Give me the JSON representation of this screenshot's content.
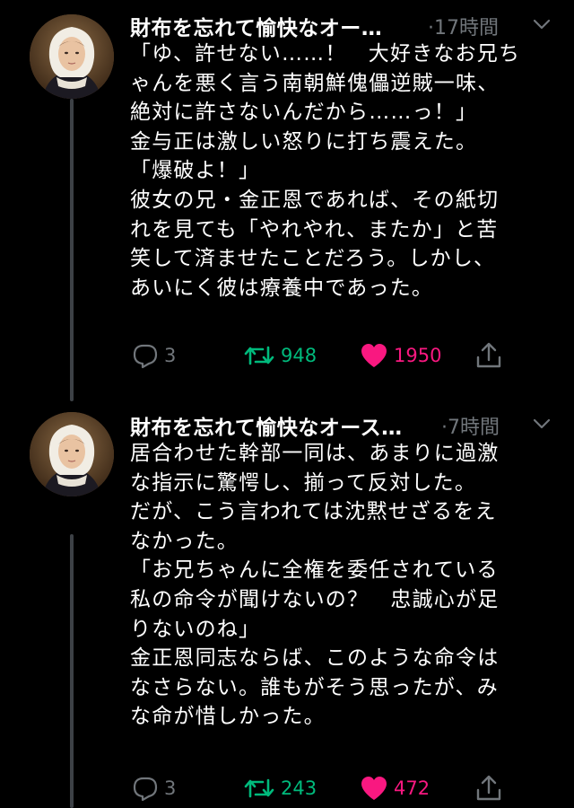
{
  "theme": {
    "background": "#000000",
    "muted": "#71767b",
    "retweet_green": "#00ba7c",
    "like_pink": "#f91880"
  },
  "tweets": [
    {
      "author": "財布を忘れて愉快なオー…",
      "time": "·17時間",
      "avatar_icon": "portrait-woman-bonnet-icon",
      "lines": [
        "「ゆ、許せない……！　大好きなお兄ち",
        "ゃんを悪く言う南朝鮮傀儡逆賊一味、",
        "絶対に許さないんだから……っ！」",
        "金与正は激しい怒りに打ち震えた。",
        "「爆破よ！」",
        "彼女の兄・金正恩であれば、その紙切",
        "れを見ても「やれやれ、またか」と苦",
        "笑して済ませたことだろう。しかし、",
        "あいにく彼は療養中であった。"
      ],
      "replies": "3",
      "retweets": "948",
      "likes": "1950"
    },
    {
      "author": "財布を忘れて愉快なオース…",
      "time": "·7時間",
      "avatar_icon": "portrait-woman-bonnet-icon",
      "lines": [
        "居合わせた幹部一同は、あまりに過激",
        "な指示に驚愕し、揃って反対した。",
        "だが、こう言われては沈黙せざるをえ",
        "なかった。",
        "「お兄ちゃんに全権を委任されている",
        "私の命令が聞けないの？　忠誠心が足",
        "りないのね」",
        "金正恩同志ならば、このような命令は",
        "なさらない。誰もがそう思ったが、み",
        "な命が惜しかった。"
      ],
      "replies": "3",
      "retweets": "243",
      "likes": "472"
    }
  ]
}
